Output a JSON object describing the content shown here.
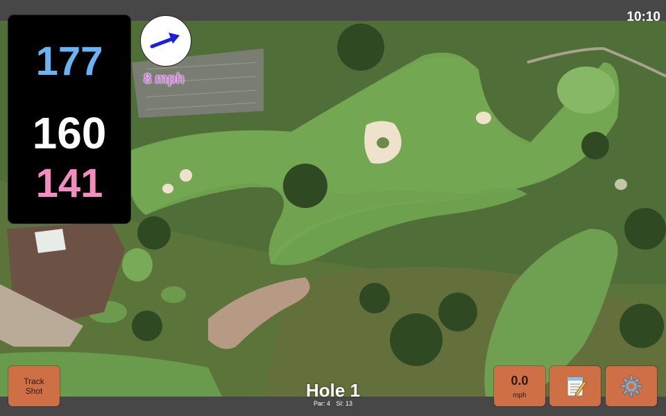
{
  "status": {
    "time": "10:10"
  },
  "yardage": {
    "back": "177",
    "middle": "160",
    "front": "141",
    "colors": {
      "back": "#6cb3f3",
      "middle": "#ffffff",
      "front": "#f48cc0"
    }
  },
  "wind": {
    "speed_label": "8 mph",
    "arrow_icon": "wind-direction-arrow",
    "arrow_color": "#1a1ee0"
  },
  "hole": {
    "title": "Hole 1",
    "par_label": "Par: 4",
    "si_label": "SI: 13"
  },
  "buttons": {
    "track_shot": {
      "line1": "Track",
      "line2": "Shot"
    },
    "speed": {
      "value": "0.0",
      "unit": "mph"
    },
    "notes": {
      "icon": "notepad-icon"
    },
    "settings": {
      "icon": "gear-icon"
    }
  },
  "colors": {
    "button_bg": "#cf6f45",
    "bar_bg": "#474747"
  }
}
